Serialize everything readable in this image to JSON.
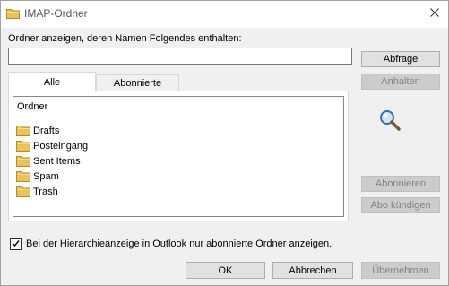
{
  "window": {
    "title": "IMAP-Ordner",
    "title_icon": "folder-icon",
    "close_icon": "close-icon"
  },
  "filter": {
    "label": "Ordner anzeigen, deren Namen Folgendes enthalten:",
    "value": ""
  },
  "buttons": {
    "query": "Abfrage",
    "stop": "Anhalten",
    "subscribe": "Abonnieren",
    "unsubscribe": "Abo kündigen",
    "ok": "OK",
    "cancel": "Abbrechen",
    "apply": "Übernehmen"
  },
  "tabs": [
    {
      "label": "Alle",
      "active": true
    },
    {
      "label": "Abonnierte",
      "active": false
    }
  ],
  "list": {
    "column_header": "Ordner",
    "items": [
      "Drafts",
      "Posteingang",
      "Sent Items",
      "Spam",
      "Trash"
    ],
    "item_icon": "folder-icon"
  },
  "search_icon": "magnifier-icon",
  "option": {
    "checked": true,
    "label": "Bei der Hierarchieanzeige in Outlook nur abonnierte Ordner anzeigen."
  },
  "colors": {
    "folder": "#e8c25a",
    "default_button_border": "#0078d7",
    "disabled_text": "#838383"
  }
}
